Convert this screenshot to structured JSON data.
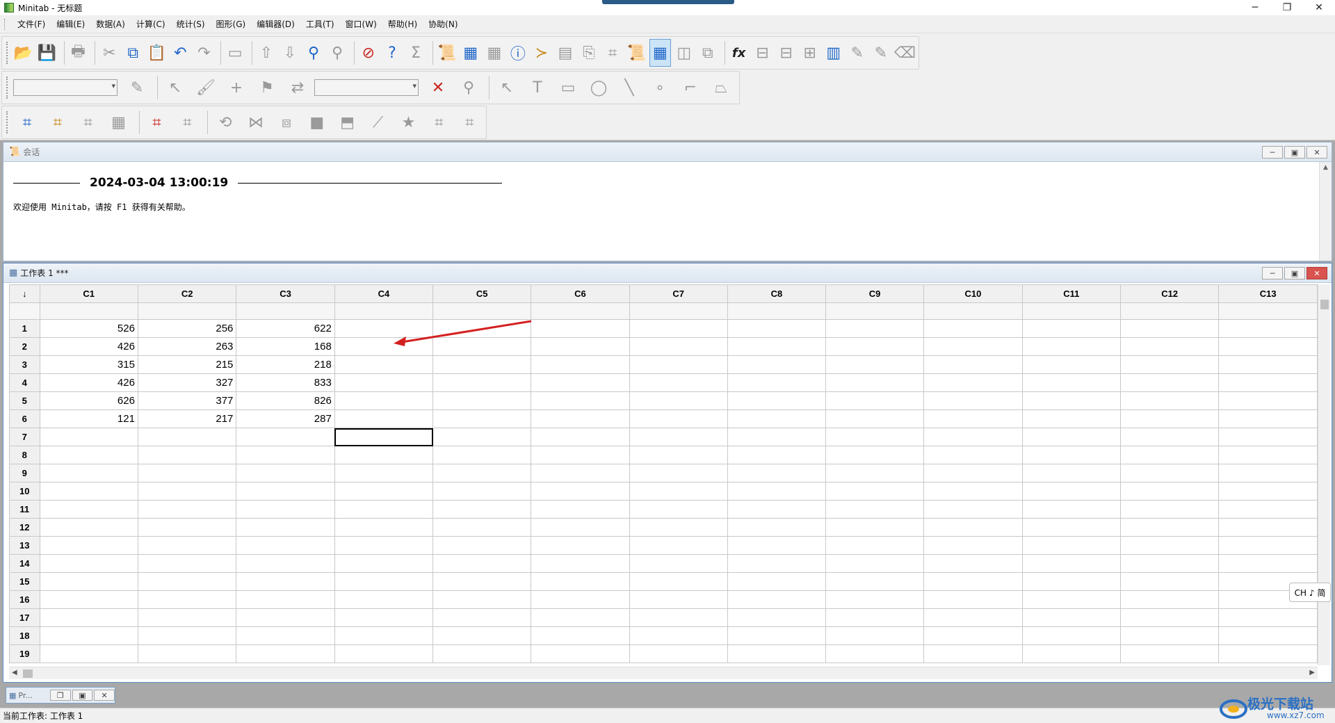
{
  "window": {
    "title": "Minitab - 无标题",
    "controls": {
      "minimize": "─",
      "restore": "❐",
      "close": "✕"
    }
  },
  "menu": [
    "文件(F)",
    "编辑(E)",
    "数据(A)",
    "计算(C)",
    "统计(S)",
    "图形(G)",
    "编辑器(D)",
    "工具(T)",
    "窗口(W)",
    "帮助(H)",
    "协助(N)"
  ],
  "toolbar1": {
    "buttons": [
      {
        "name": "open-icon",
        "glyph": "📂",
        "tone": "gold"
      },
      {
        "name": "save-icon",
        "glyph": "💾",
        "tone": "blue"
      },
      {
        "name": "print-icon",
        "glyph": "🖶",
        "tone": "grey"
      },
      {
        "name": "cut-icon",
        "glyph": "✂",
        "tone": "grey"
      },
      {
        "name": "copy-icon",
        "glyph": "⧉",
        "tone": "blue"
      },
      {
        "name": "paste-icon",
        "glyph": "📋",
        "tone": "gold"
      },
      {
        "name": "undo-icon",
        "glyph": "↶",
        "tone": "blue"
      },
      {
        "name": "redo-icon",
        "glyph": "↷",
        "tone": "grey"
      },
      {
        "name": "edit-last-dialog-icon",
        "glyph": "▭",
        "tone": "grey"
      },
      {
        "name": "previous-icon",
        "glyph": "⇧",
        "tone": "grey"
      },
      {
        "name": "next-icon",
        "glyph": "⇩",
        "tone": "grey"
      },
      {
        "name": "find-icon",
        "glyph": "⚲",
        "tone": "blue"
      },
      {
        "name": "replace-icon",
        "glyph": "⚲",
        "tone": "grey"
      },
      {
        "name": "cancel-icon",
        "glyph": "⊘",
        "tone": "red"
      },
      {
        "name": "help-icon",
        "glyph": "?",
        "tone": "blue"
      },
      {
        "name": "statguide-icon",
        "glyph": "Σ",
        "tone": "grey"
      },
      {
        "name": "session-window-icon",
        "glyph": "📜",
        "tone": "gold"
      },
      {
        "name": "worksheet-icon",
        "glyph": "▦",
        "tone": "blue"
      },
      {
        "name": "graph-icon",
        "glyph": "▦",
        "tone": "grey"
      },
      {
        "name": "info-icon",
        "glyph": "ⓘ",
        "tone": "blue"
      },
      {
        "name": "history-icon",
        "glyph": "≻",
        "tone": "gold"
      },
      {
        "name": "report-pad-icon",
        "glyph": "▤",
        "tone": "grey"
      },
      {
        "name": "new-document-icon",
        "glyph": "⎘",
        "tone": "grey"
      },
      {
        "name": "layout-icon",
        "glyph": "⌗",
        "tone": "grey"
      },
      {
        "name": "related-documents-icon",
        "glyph": "📜",
        "tone": "gold"
      },
      {
        "name": "worksheet-view-icon",
        "glyph": "▦",
        "tone": "blue",
        "active": true
      },
      {
        "name": "split-view-icon",
        "glyph": "◫",
        "tone": "grey"
      },
      {
        "name": "close-all-graphs-icon",
        "glyph": "⧉",
        "tone": "grey"
      },
      {
        "name": "formula-icon",
        "glyph": "fx",
        "tone": "grey"
      },
      {
        "name": "insert-cells-icon",
        "glyph": "⊟",
        "tone": "grey"
      },
      {
        "name": "insert-rows-icon",
        "glyph": "⊟",
        "tone": "grey"
      },
      {
        "name": "insert-columns-icon",
        "glyph": "⊞",
        "tone": "grey"
      },
      {
        "name": "move-columns-icon",
        "glyph": "▥",
        "tone": "blue"
      },
      {
        "name": "define-formula-icon",
        "glyph": "✎",
        "tone": "grey"
      },
      {
        "name": "clear-formula-icon",
        "glyph": "✎",
        "tone": "grey"
      },
      {
        "name": "eraser-icon",
        "glyph": "⌫",
        "tone": "grey"
      }
    ]
  },
  "toolbar2": {
    "combo_left": "",
    "combo_right": "",
    "buttons": [
      {
        "name": "brush-icon",
        "glyph": "✎",
        "tone": "grey"
      },
      {
        "name": "select-pointer-icon",
        "glyph": "↖",
        "tone": "grey"
      },
      {
        "name": "paint-brush-icon",
        "glyph": "🖌",
        "tone": "grey"
      },
      {
        "name": "crosshair-icon",
        "glyph": "+",
        "tone": "grey"
      },
      {
        "name": "flag-icon",
        "glyph": "⚑",
        "tone": "grey"
      },
      {
        "name": "swap-icon",
        "glyph": "⇄",
        "tone": "grey"
      },
      {
        "name": "delete-icon",
        "glyph": "✕",
        "tone": "red"
      },
      {
        "name": "zoom-icon",
        "glyph": "⚲",
        "tone": "grey"
      },
      {
        "name": "pointer-tool-icon",
        "glyph": "↖",
        "tone": "grey"
      },
      {
        "name": "text-tool-icon",
        "glyph": "T",
        "tone": "grey"
      },
      {
        "name": "rectangle-tool-icon",
        "glyph": "▭",
        "tone": "grey"
      },
      {
        "name": "ellipse-tool-icon",
        "glyph": "◯",
        "tone": "grey"
      },
      {
        "name": "line-tool-icon",
        "glyph": "╲",
        "tone": "grey"
      },
      {
        "name": "point-tool-icon",
        "glyph": "∘",
        "tone": "grey"
      },
      {
        "name": "polyline-tool-icon",
        "glyph": "⌐",
        "tone": "grey"
      },
      {
        "name": "polygon-tool-icon",
        "glyph": "⏢",
        "tone": "grey"
      }
    ]
  },
  "toolbar3": {
    "buttons": [
      {
        "name": "graph-region-icon",
        "glyph": "⌗",
        "tone": "blue"
      },
      {
        "name": "graph-region-edit-icon",
        "glyph": "⌗",
        "tone": "gold"
      },
      {
        "name": "data-region-icon",
        "glyph": "⌗",
        "tone": "grey"
      },
      {
        "name": "gridlines-icon",
        "glyph": "▦",
        "tone": "grey"
      },
      {
        "name": "figure-region-icon",
        "glyph": "⌗",
        "tone": "red"
      },
      {
        "name": "legend-region-icon",
        "glyph": "⌗",
        "tone": "grey"
      },
      {
        "name": "rotate-icon",
        "glyph": "⟲",
        "tone": "grey"
      },
      {
        "name": "axis-icon",
        "glyph": "⋈",
        "tone": "grey"
      },
      {
        "name": "3d-box-icon",
        "glyph": "⧈",
        "tone": "grey"
      },
      {
        "name": "shading-icon",
        "glyph": "■",
        "tone": "grey"
      },
      {
        "name": "surface-icon",
        "glyph": "⬒",
        "tone": "grey"
      },
      {
        "name": "perspective-icon",
        "glyph": "⟋",
        "tone": "grey"
      },
      {
        "name": "star-icon",
        "glyph": "★",
        "tone": "grey"
      },
      {
        "name": "resize-icon",
        "glyph": "⌗",
        "tone": "grey"
      },
      {
        "name": "fit-icon",
        "glyph": "⌗",
        "tone": "grey"
      }
    ]
  },
  "session": {
    "title": "会话",
    "timestamp": "2024-03-04 13:00:19",
    "message": "欢迎使用 Minitab，请按 F1 获得有关帮助。"
  },
  "worksheet": {
    "title": "工作表 1 ***",
    "corner": "↓",
    "columns": [
      "C1",
      "C2",
      "C3",
      "C4",
      "C5",
      "C6",
      "C7",
      "C8",
      "C9",
      "C10",
      "C11",
      "C12",
      "C13"
    ],
    "row_numbers": [
      "1",
      "2",
      "3",
      "4",
      "5",
      "6",
      "7",
      "8",
      "9",
      "10",
      "11",
      "12",
      "13",
      "14",
      "15",
      "16",
      "17",
      "18",
      "19"
    ],
    "data": [
      [
        "526",
        "256",
        "622"
      ],
      [
        "426",
        "263",
        "168"
      ],
      [
        "315",
        "215",
        "218"
      ],
      [
        "426",
        "327",
        "833"
      ],
      [
        "626",
        "377",
        "826"
      ],
      [
        "121",
        "217",
        "287"
      ]
    ],
    "selected_cell": {
      "row": 7,
      "col": "C4"
    }
  },
  "minimized": {
    "title": "Pr..."
  },
  "ime": "CH ♪ 简",
  "statusbar": "当前工作表: 工作表 1",
  "watermark": {
    "main": "极光下载站",
    "sub": "www.xz7.com"
  },
  "colors": {
    "accent": "#2a5a86",
    "annotation": "#d42020"
  }
}
